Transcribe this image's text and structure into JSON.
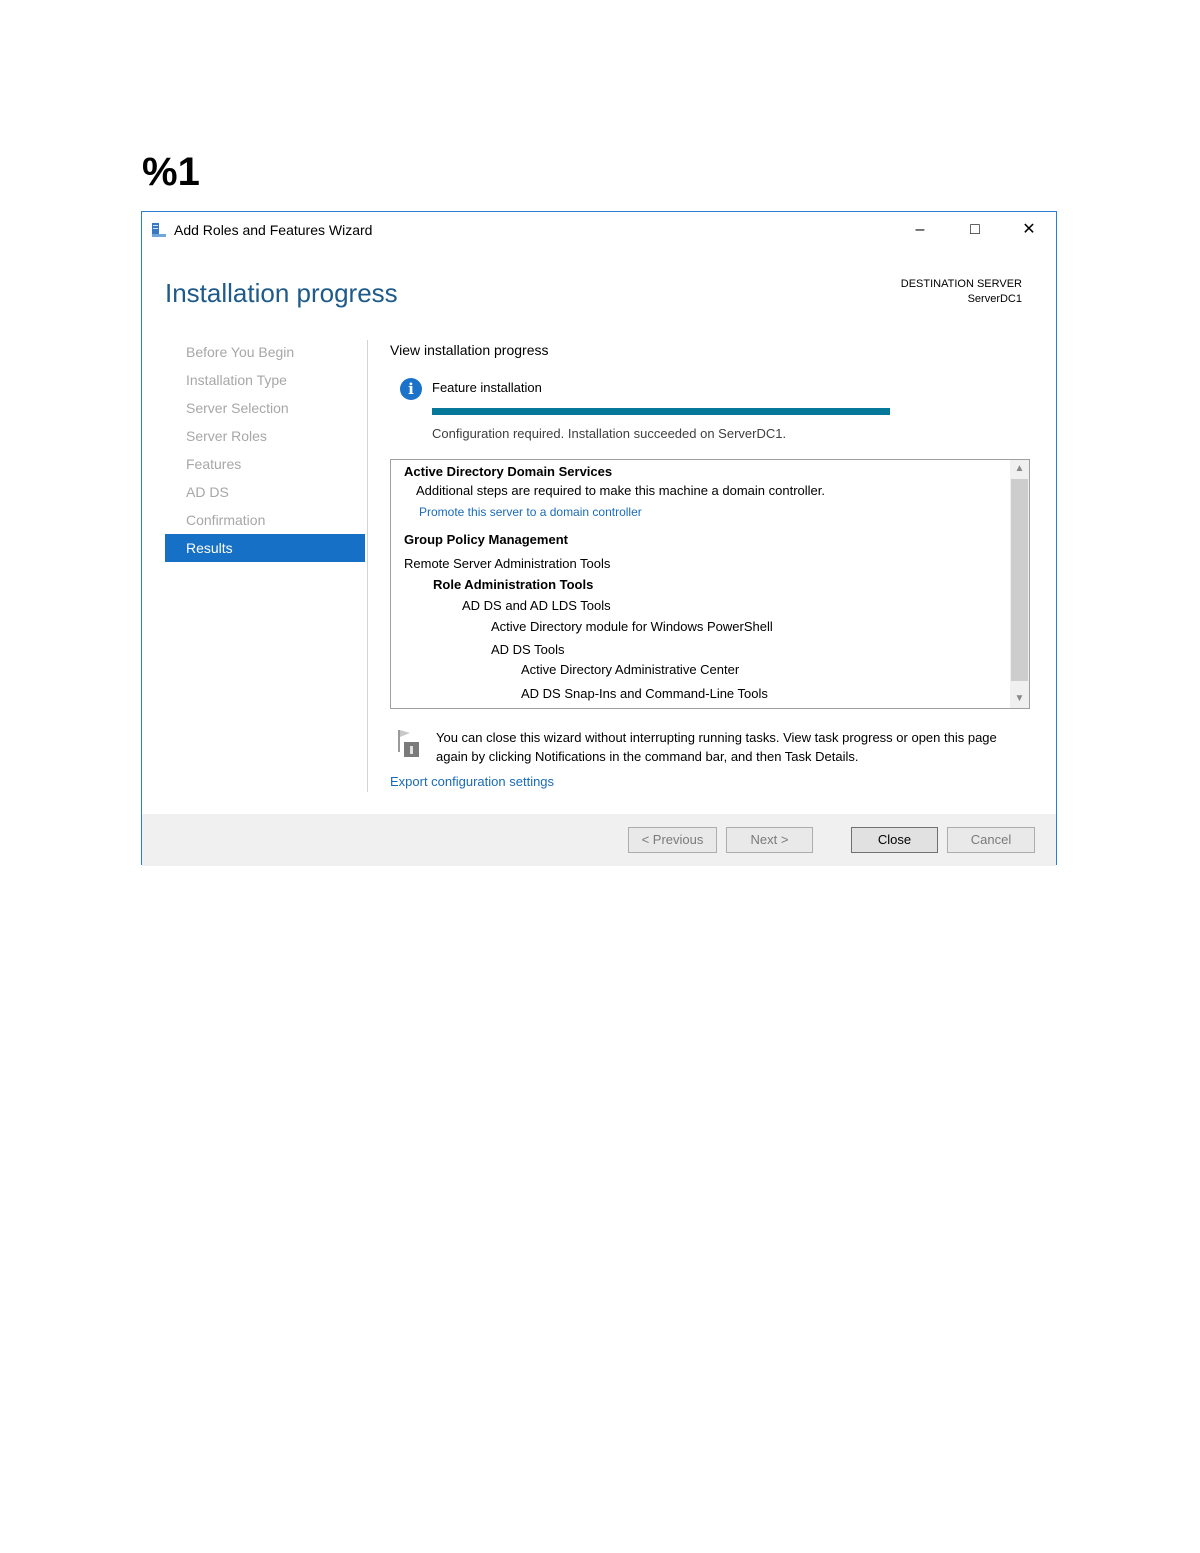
{
  "document": {
    "heading": "%1"
  },
  "window": {
    "title": "Add Roles and Features Wizard",
    "controls": {
      "minimize": "–",
      "maximize": "□",
      "close": "✕"
    }
  },
  "header": {
    "page_title": "Installation progress",
    "destination_label": "DESTINATION SERVER",
    "destination_server": "ServerDC1"
  },
  "nav": {
    "items": [
      {
        "label": "Before You Begin",
        "active": false
      },
      {
        "label": "Installation Type",
        "active": false
      },
      {
        "label": "Server Selection",
        "active": false
      },
      {
        "label": "Server Roles",
        "active": false
      },
      {
        "label": "Features",
        "active": false
      },
      {
        "label": "AD DS",
        "active": false
      },
      {
        "label": "Confirmation",
        "active": false
      },
      {
        "label": "Results",
        "active": true
      }
    ]
  },
  "main": {
    "sub_heading": "View installation progress",
    "feature_label": "Feature installation",
    "progress_fraction": 1.0,
    "status": "Configuration required. Installation succeeded on ServerDC1.",
    "results": [
      {
        "text": "Active Directory Domain Services",
        "indent": 0,
        "style": "bold"
      },
      {
        "text": "Additional steps are required to make this machine a domain controller.",
        "indent": 1,
        "style": "normal"
      },
      {
        "text": "Promote this server to a domain controller",
        "indent": 1,
        "style": "link"
      },
      {
        "text": "Group Policy Management",
        "indent": 0,
        "style": "bold"
      },
      {
        "text": "Remote Server Administration Tools",
        "indent": 0,
        "style": "normal"
      },
      {
        "text": "Role Administration Tools",
        "indent": 1,
        "style": "bold"
      },
      {
        "text": "AD DS and AD LDS Tools",
        "indent": 2,
        "style": "normal"
      },
      {
        "text": "Active Directory module for Windows PowerShell",
        "indent": 3,
        "style": "normal"
      },
      {
        "text": "AD DS Tools",
        "indent": 3,
        "style": "normal"
      },
      {
        "text": "Active Directory Administrative Center",
        "indent": 4,
        "style": "normal"
      },
      {
        "text": "AD DS Snap-Ins and Command-Line Tools",
        "indent": 4,
        "style": "normal"
      }
    ],
    "note": "You can close this wizard without interrupting running tasks. View task progress or open this page again by clicking Notifications in the command bar, and then Task Details.",
    "export_link": "Export configuration settings"
  },
  "footer": {
    "previous_label": "< Previous",
    "next_label": "Next >",
    "close_label": "Close",
    "cancel_label": "Cancel"
  },
  "colors": {
    "accent": "#1570c6",
    "progress": "#06789a",
    "title": "#1e5a8a",
    "link": "#1a6bb8"
  },
  "icons": {
    "app": "server-manager-icon",
    "info": "info-icon",
    "note": "notification-flag-icon"
  }
}
